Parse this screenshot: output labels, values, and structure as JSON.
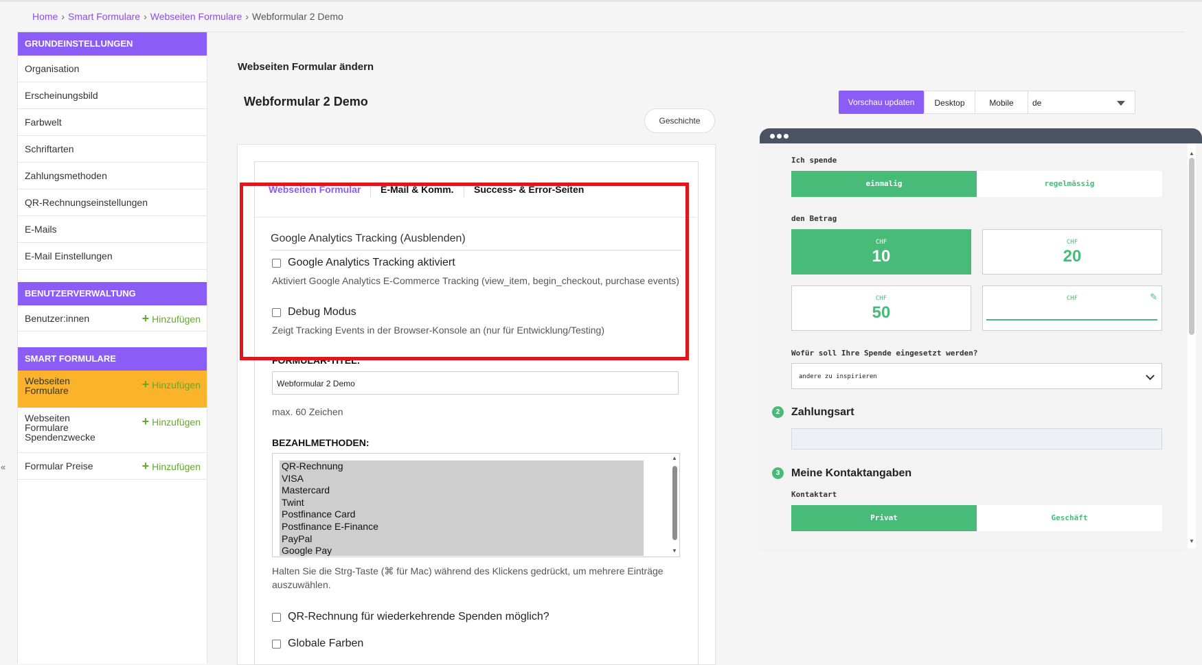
{
  "breadcrumb": {
    "home": "Home",
    "smart_formulare": "Smart Formulare",
    "webseiten_formulare": "Webseiten Formulare",
    "current": "Webformular 2 Demo",
    "separator": "›"
  },
  "sidebar": {
    "grundeinstellungen": {
      "title": "GRUNDEINSTELLUNGEN",
      "items": [
        "Organisation",
        "Erscheinungsbild",
        "Farbwelt",
        "Schriftarten",
        "Zahlungsmethoden",
        "QR-Rechnungseinstellungen",
        "E-Mails",
        "E-Mail Einstellungen"
      ]
    },
    "benutzerverwaltung": {
      "title": "BENUTZERVERWALTUNG",
      "item": "Benutzer:innen",
      "add": "Hinzufügen"
    },
    "smart_formulare": {
      "title": "SMART FORMULARE",
      "items": [
        {
          "line1": "Webseiten",
          "line2": "Formulare",
          "line3": "",
          "add": "Hinzufügen"
        },
        {
          "line1": "Webseiten",
          "line2": "Formulare",
          "line3": "Spendenzwecke",
          "add": "Hinzufügen"
        },
        {
          "line1": "Formular Preise",
          "line2": "",
          "line3": "",
          "add": "Hinzufügen"
        }
      ]
    },
    "collapse": "«"
  },
  "main": {
    "page_heading": "Webseiten Formular ändern",
    "form_title": "Webformular 2 Demo",
    "history_button": "Geschichte",
    "tabs": [
      "Webseiten Formular",
      "E-Mail & Komm.",
      "Success- & Error-Seiten"
    ],
    "ga_section_title": "Google Analytics Tracking (Ausblenden)",
    "ga_checkbox_label": "Google Analytics Tracking aktiviert",
    "ga_help": "Aktiviert Google Analytics E-Commerce Tracking (view_item, begin_checkout, purchase events)",
    "debug_checkbox_label": "Debug Modus",
    "debug_help": "Zeigt Tracking Events in der Browser-Konsole an (nur für Entwicklung/Testing)",
    "title_label": "FORMULAR-TITEL:",
    "title_value": "Webformular 2 Demo",
    "title_help": "max. 60 Zeichen",
    "payment_label": "BEZAHLMETHODEN:",
    "payment_options": [
      "QR-Rechnung",
      "VISA",
      "Mastercard",
      "Twint",
      "Postfinance Card",
      "Postfinance E-Finance",
      "PayPal",
      "Google Pay"
    ],
    "payment_help_line1": "Halten Sie die Strg-Taste (⌘ für Mac) während des Klickens gedrückt, um mehrere Einträge",
    "payment_help_line2": "auszuwählen.",
    "qr_recurring_label": "QR-Rechnung für wiederkehrende Spenden möglich?",
    "global_colors_label": "Globale Farben"
  },
  "preview_toolbar": {
    "update_button": "Vorschau updaten",
    "desktop": "Desktop",
    "mobile": "Mobile",
    "language": "de"
  },
  "preview": {
    "donate_label": "Ich spende",
    "freq_options": [
      "einmalig",
      "regelmässig"
    ],
    "amount_label": "den Betrag",
    "currency": "CHF",
    "amounts": [
      "10",
      "20",
      "50"
    ],
    "purpose_question": "Wofür soll Ihre Spende eingesetzt werden?",
    "purpose_value": "andere zu inspirieren",
    "step2_number": "2",
    "step2_title": "Zahlungsart",
    "step3_number": "3",
    "step3_title": "Meine Kontaktangaben",
    "contact_type_label": "Kontaktart",
    "contact_options": [
      "Privat",
      "Geschäft"
    ]
  },
  "colors": {
    "accent": "#8b5cf6",
    "active_item": "#fbb32c",
    "preview_green": "#48bb78",
    "highlight_box": "#e0161c",
    "add_link": "#62a92a"
  }
}
